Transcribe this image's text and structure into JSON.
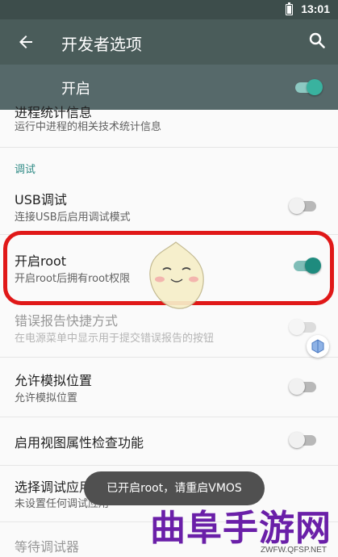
{
  "statusbar": {
    "time": "13:01"
  },
  "appbar": {
    "title": "开发者选项"
  },
  "master_toggle": {
    "label": "开启",
    "checked": true
  },
  "items": {
    "process_stats_title": "进程统计信息",
    "process_stats_sub": "运行中进程的相关技术统计信息",
    "section_debug": "调试",
    "usb_title": "USB调试",
    "usb_sub": "连接USB后启用调试模式",
    "root_title": "开启root",
    "root_sub": "开启root后拥有root权限",
    "bugreport_title": "错误报告快捷方式",
    "bugreport_sub": "在电源菜单中显示用于提交错误报告的按钮",
    "mock_title": "允许模拟位置",
    "mock_sub": "允许模拟位置",
    "view_attr_title": "启用视图属性检查功能",
    "debug_app_title": "选择调试应用",
    "debug_app_sub": "未设置任何调试应用",
    "wait_debugger_title": "等待调试器"
  },
  "toggles": {
    "usb": false,
    "root": true,
    "bugreport": false,
    "mock": false,
    "view_attr": false
  },
  "toast": {
    "text": "已开启root，请重启VMOS"
  },
  "watermark": {
    "brand": "曲阜手游网",
    "url": "ZWFW.QFSP.NET"
  },
  "colors": {
    "appbar": "#4a5c5a",
    "accent": "#1e8b7e",
    "highlight": "#e01818",
    "watermark": "#6a1fa8"
  }
}
